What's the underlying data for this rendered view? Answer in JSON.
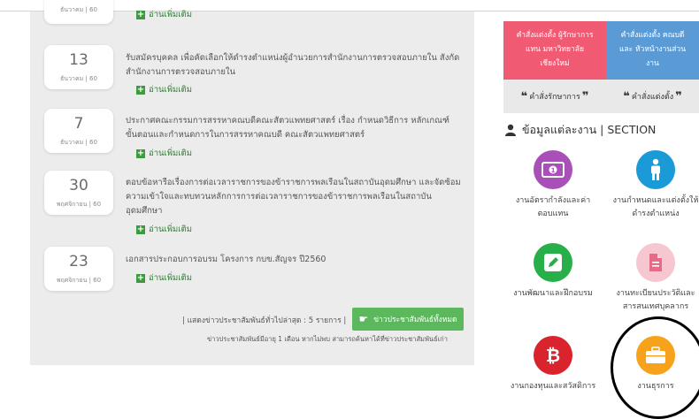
{
  "news": {
    "top_partial_date": "ธันวาคม | 60",
    "top_partial_readmore": "อ่านเพิ่มเติม",
    "items": [
      {
        "day": "13",
        "month": "ธันวาคม | 60",
        "text": "รับสมัครบุคคล เพื่อคัดเลือกให้ดำรงตำแหน่งผู้อำนวยการสำนักงานการตรวจสอบภายใน สังกัดสำนักงานการตรวจสอบภายใน",
        "readmore": "อ่านเพิ่มเติม"
      },
      {
        "day": "7",
        "month": "ธันวาคม | 60",
        "text": "ประกาศคณะกรรมการสรรหาคณบดีคณะสัตวแพทยศาสตร์ เรื่อง กำหนดวิธีการ หลักเกณฑ์ ขั้นตอนและกำหนดการในการสรรหาคณบดี คณะสัตวแพทยศาสตร์",
        "readmore": "อ่านเพิ่มเติม"
      },
      {
        "day": "30",
        "month": "พฤศจิกายน | 60",
        "text": "ตอบข้อหารือเรื่องการต่อเวลาราชการของข้าราชการพลเรือนในสถาบันอุดมศึกษา และจัดซ้อมความเข้าใจและทบทวนหลักการการต่อเวลาราชการของข้าราชการพลเรือนในสถาบันอุดมศึกษา",
        "readmore": "อ่านเพิ่มเติม"
      },
      {
        "day": "23",
        "month": "พฤศจิกายน | 60",
        "text": "เอกสารประกอบการอบรม โครงการ กบข.สัญจร ปี2560",
        "readmore": "อ่านเพิ่มเติม"
      }
    ],
    "summary_label": "| แสดงข่าวประชาสัมพันธ์ทั่วไปล่าสุด : 5 รายการ |",
    "all_news_button": "ข่าวประชาสัมพันธ์ทั้งหมด",
    "note": "ข่าวประชาสัมพันธ์มีอายุ 1 เดือน หากไม่พบ สามารถค้นหาได้ที่ข่าวประชาสัมพันธ์เก่า"
  },
  "top_cards": [
    {
      "title": "คำสั่งแต่งตั้ง ผู้รักษาการแทน มหาวิทยาลัยเชียงใหม่",
      "link": "คำสั่งรักษาการ",
      "color": "#f05a72"
    },
    {
      "title": "คำสั่งแต่งตั้ง คณบดีและ หัวหน้างานส่วนงาน",
      "link": "คำสั่งแต่งตั้ง",
      "color": "#5b9bd5"
    }
  ],
  "section": {
    "title": "ข้อมูลแต่ละงาน | SECTION"
  },
  "tiles": [
    {
      "label": "งานอัตรากำลังและค่าตอบแทน",
      "color": "#a94fb8",
      "icon": "money-icon"
    },
    {
      "label": "งานกำหนดและแต่งตั้งให้ดำรงตำแหน่ง",
      "color": "#1a9ad6",
      "icon": "person-icon"
    },
    {
      "label": "งานพัฒนาและฝึกอบรม",
      "color": "#27b04a",
      "icon": "edit-icon"
    },
    {
      "label": "งานทะเบียนประวัติและสารสนเทศบุคลากร",
      "color": "#f6c6d1",
      "icon": "document-icon"
    },
    {
      "label": "งานกองทุนและสวัสดิการ",
      "color": "#d9232d",
      "icon": "bitcoin-icon"
    },
    {
      "label": "งานธุรการ",
      "color": "#f7a21b",
      "icon": "briefcase-icon"
    }
  ]
}
